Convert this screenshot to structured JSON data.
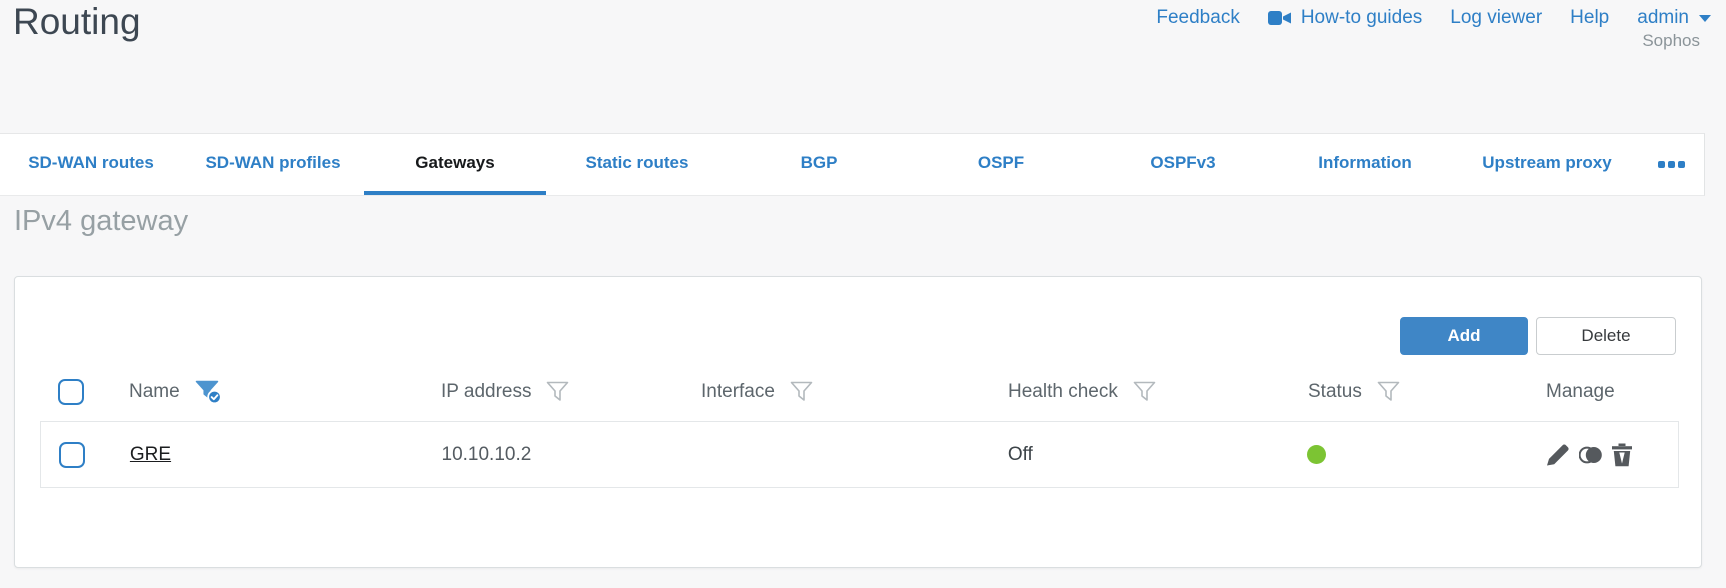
{
  "page": {
    "title": "Routing",
    "brand": "Sophos"
  },
  "header_links": {
    "feedback": "Feedback",
    "howto": "How-to guides",
    "log_viewer": "Log viewer",
    "help": "Help",
    "user": "admin"
  },
  "tabs": {
    "items": [
      {
        "label": "SD-WAN routes",
        "active": false
      },
      {
        "label": "SD-WAN profiles",
        "active": false
      },
      {
        "label": "Gateways",
        "active": true
      },
      {
        "label": "Static routes",
        "active": false
      },
      {
        "label": "BGP",
        "active": false
      },
      {
        "label": "OSPF",
        "active": false
      },
      {
        "label": "OSPFv3",
        "active": false
      },
      {
        "label": "Information",
        "active": false
      },
      {
        "label": "Upstream proxy",
        "active": false
      }
    ],
    "more": "ellipsis"
  },
  "section": {
    "heading": "IPv4 gateway"
  },
  "toolbar": {
    "add_label": "Add",
    "delete_label": "Delete"
  },
  "table": {
    "columns": [
      {
        "label": "Name",
        "filter": "active"
      },
      {
        "label": "IP address",
        "filter": "inactive"
      },
      {
        "label": "Interface",
        "filter": "inactive"
      },
      {
        "label": "Health check",
        "filter": "inactive"
      },
      {
        "label": "Status",
        "filter": "inactive"
      },
      {
        "label": "Manage",
        "filter": "none"
      }
    ],
    "rows": [
      {
        "name": "GRE",
        "ip_address": "10.10.10.2",
        "interface": "",
        "health_check": "Off",
        "status": "green",
        "status_color": "#7cc433"
      }
    ]
  },
  "colors": {
    "accent_blue": "#2e7fc6",
    "add_button": "#3f86c6",
    "status_green": "#7cc433",
    "title_text": "#3d4752",
    "section_heading_text": "#97a0a4"
  }
}
